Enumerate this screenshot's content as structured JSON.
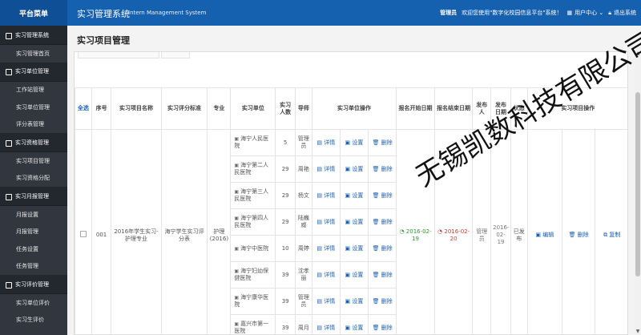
{
  "header": {
    "brand": "平台菜单",
    "title": "实习管理系统",
    "subtitle": "Intern Management System",
    "user_label": "管理员",
    "welcome": "欢迎您使用\"数字化校园信息平台\"系统！",
    "user_center": "用户中心 ⌄",
    "logout": "退出系统"
  },
  "sidebar": {
    "groups": [
      {
        "label": "实习管理系统",
        "items": [
          "实习管理首页"
        ]
      },
      {
        "label": "实习单位管理",
        "items": [
          "工作站管理",
          "实习单位管理",
          "评分表管理"
        ]
      },
      {
        "label": "实习资格管理",
        "items": [
          "实习项目管理",
          "实习资格分配"
        ]
      },
      {
        "label": "实习月报管理",
        "items": [
          "月报设置",
          "月报管理",
          "任务设置",
          "任务管理"
        ]
      },
      {
        "label": "实习评价管理",
        "items": [
          "实习单位评价",
          "实习生评价"
        ]
      }
    ]
  },
  "page": {
    "title": "实习项目管理"
  },
  "table": {
    "headers": {
      "select_all": "全选",
      "index": "序号",
      "name": "实习项目名称",
      "standard": "实习评分标准",
      "major": "专业",
      "unit": "实习单位",
      "count": "实习人数",
      "mentor": "导师",
      "unit_ops": "实习单位操作",
      "start": "报名开始日期",
      "end": "报名结束日期",
      "publisher": "发布人",
      "pub_date": "发布日期",
      "status": "状态",
      "project_ops": "实习项目操作"
    },
    "row": {
      "index": "001",
      "name": "2016年学生实习-护理专业",
      "standard": "海宁学生实习评分表",
      "major": "护理(2016)",
      "start": "2016-02-19",
      "end": "2016-02-20",
      "publisher": "管理员",
      "pub_date": "2016-02-19",
      "status": "已发布",
      "ops": {
        "edit": "编辑",
        "delete": "删除",
        "copy": "复制"
      }
    },
    "unit_op_labels": {
      "detail": "详情",
      "setting": "设置",
      "delete": "删除"
    },
    "units": [
      {
        "name": "海宁人民医院",
        "count": "5",
        "mentor": "管理员"
      },
      {
        "name": "海宁第二人民医院",
        "count": "29",
        "mentor": "周艳"
      },
      {
        "name": "海宁第三人民医院",
        "count": "29",
        "mentor": "杨文"
      },
      {
        "name": "海宁第四人民医院",
        "count": "29",
        "mentor": "陆巍威"
      },
      {
        "name": "海宁中医院",
        "count": "10",
        "mentor": "周婷"
      },
      {
        "name": "海宁妇幼保健医院",
        "count": "39",
        "mentor": "沈孝丽"
      },
      {
        "name": "海宁康华医院",
        "count": "39",
        "mentor": "管理员"
      },
      {
        "name": "嘉兴市第一医院",
        "count": "39",
        "mentor": "周月"
      }
    ]
  },
  "watermark": "无锡凯数科技有限公司",
  "colors": {
    "topbar": "#1660b0",
    "sidebar": "#32363f",
    "accent": "#1a5fae",
    "start_date": "#2f9b2f",
    "end_date": "#d8362f"
  }
}
